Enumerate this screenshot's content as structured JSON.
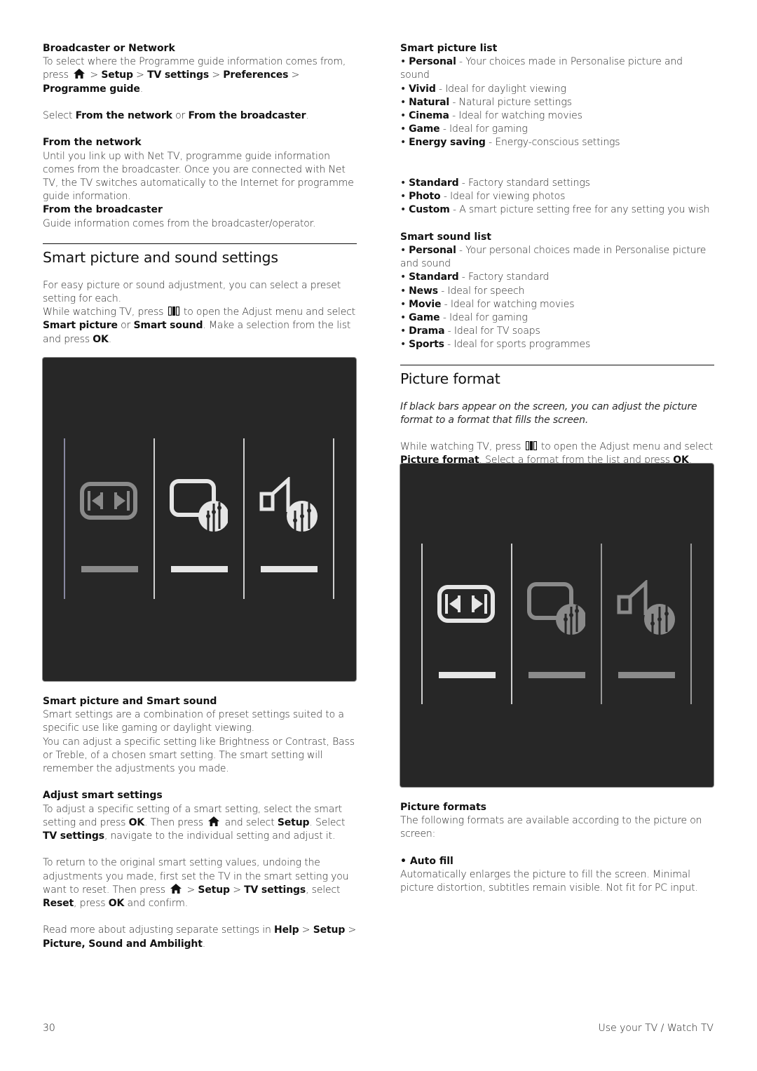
{
  "left": {
    "broadcaster": {
      "heading": "Broadcaster or Network",
      "line1": "To select where the Programme guide information comes from,",
      "press": "press",
      "home_icon": "home-icon",
      "sep": ">",
      "path": [
        "Setup",
        "TV settings",
        "Preferences",
        "Programme guide"
      ],
      "period": ".",
      "select_text": "Select",
      "opt1": "From the network",
      "or": "or",
      "opt2": "From the broadcaster"
    },
    "from_network": {
      "heading": "From the network",
      "body": "Until you link up with Net TV, programme guide information comes from the broadcaster. Once you are connected with Net TV, the TV switches automatically to the Internet for programme guide information."
    },
    "from_broadcaster": {
      "heading": "From the broadcaster",
      "body": "Guide information comes from the broadcaster/operator."
    },
    "smart_section": {
      "title": "Smart picture and sound settings",
      "intro": "For easy picture or sound adjustment, you can select a preset setting for each.",
      "p2_a": "While watching TV, press",
      "adjust_icon": "adjust-icon",
      "p2_b": "to open the Adjust menu and select",
      "p2_bold1": "Smart picture",
      "p2_or": "or",
      "p2_bold2": "Smart sound",
      "p2_c": ". Make a selection from the list and press",
      "p2_ok": "OK",
      "p2_end": "."
    },
    "panel": {
      "tiles": [
        {
          "icon": "picture-format-icon",
          "state": "dimmed"
        },
        {
          "icon": "smart-picture-icon",
          "state": "active"
        },
        {
          "icon": "smart-sound-icon",
          "state": "active"
        }
      ]
    },
    "smart_both": {
      "heading": "Smart picture and Smart sound",
      "body1": "Smart settings are a combination of preset settings suited to a specific use like gaming or daylight viewing.",
      "body2": "You can adjust a specific setting like Brightness or Contrast, Bass or Treble, of a chosen smart setting. The smart setting will remember the adjustments you made."
    },
    "adjust_smart": {
      "heading": "Adjust smart settings",
      "a": "To adjust a specific setting of a smart setting, select the smart setting and press",
      "ok": "OK",
      "b": ". Then press",
      "c": "and select",
      "setup": "Setup",
      "d": ". Select",
      "tvs": "TV settings",
      "e": ", navigate to the individual setting and adjust it."
    },
    "reset": {
      "a": "To return to the original smart setting values, undoing the adjustments you made, first set the TV in the smart setting you want to reset. Then press",
      "setup": "Setup",
      "tvs": "TV settings",
      "b": ", select",
      "reset": "Reset",
      "c": ", press",
      "ok": "OK",
      "d": "and confirm."
    },
    "readmore": {
      "a": "Read more about adjusting separate settings in",
      "help": "Help",
      "setup": "Setup",
      "psa": "Picture, Sound and Ambilight",
      "end": "."
    }
  },
  "right": {
    "smart_picture_list": {
      "heading": "Smart picture list",
      "items": [
        {
          "name": "Personal",
          "desc": "Your choices made in Personalise picture and sound"
        },
        {
          "name": "Vivid",
          "desc": "Ideal for daylight viewing"
        },
        {
          "name": "Natural",
          "desc": "Natural picture settings"
        },
        {
          "name": "Cinema",
          "desc": "Ideal for watching movies"
        },
        {
          "name": "Game",
          "desc": "Ideal for gaming"
        },
        {
          "name": "Energy saving",
          "desc": "Energy-conscious settings"
        }
      ],
      "items2": [
        {
          "name": "Standard",
          "desc": "Factory standard settings"
        },
        {
          "name": "Photo",
          "desc": "Ideal for viewing photos"
        },
        {
          "name": "Custom",
          "desc": "A smart picture setting free for any setting you wish"
        }
      ]
    },
    "smart_sound_list": {
      "heading": "Smart sound list",
      "items": [
        {
          "name": "Personal",
          "desc": "Your personal choices made in Personalise picture and sound"
        },
        {
          "name": "Standard",
          "desc": "Factory standard"
        },
        {
          "name": "News",
          "desc": "Ideal for speech"
        },
        {
          "name": "Movie",
          "desc": "Ideal for watching movies"
        },
        {
          "name": "Game",
          "desc": "Ideal for gaming"
        },
        {
          "name": "Drama",
          "desc": "Ideal for TV soaps"
        },
        {
          "name": "Sports",
          "desc": "Ideal for sports programmes"
        }
      ]
    },
    "picture_format": {
      "title": "Picture format",
      "intro": "If black bars appear on the screen, you can adjust the picture format to a format that fills the screen.",
      "p_a": "While watching TV, press",
      "p_b": "to open the Adjust menu and select",
      "p_bold": "Picture format",
      "p_c": ". Select a format from the list and press",
      "p_ok": "OK",
      "p_end": "."
    },
    "panel": {
      "tiles": [
        {
          "icon": "picture-format-icon",
          "state": "active"
        },
        {
          "icon": "smart-picture-icon",
          "state": "dimmed"
        },
        {
          "icon": "smart-sound-icon",
          "state": "dimmed"
        }
      ]
    },
    "formats": {
      "heading": "Picture formats",
      "intro": "The following formats are available according to the picture on screen:",
      "item": "Auto fill",
      "item_desc": "Automatically enlarges the picture to fill the screen. Minimal picture distortion, subtitles remain visible. Not fit for PC input."
    }
  },
  "footer": {
    "page_number": "30",
    "section": "Use your TV / Watch TV"
  },
  "colors": {
    "panel_bg": "#272727",
    "active": "#e6e6e6",
    "dimmed": "#8a8a8a"
  }
}
